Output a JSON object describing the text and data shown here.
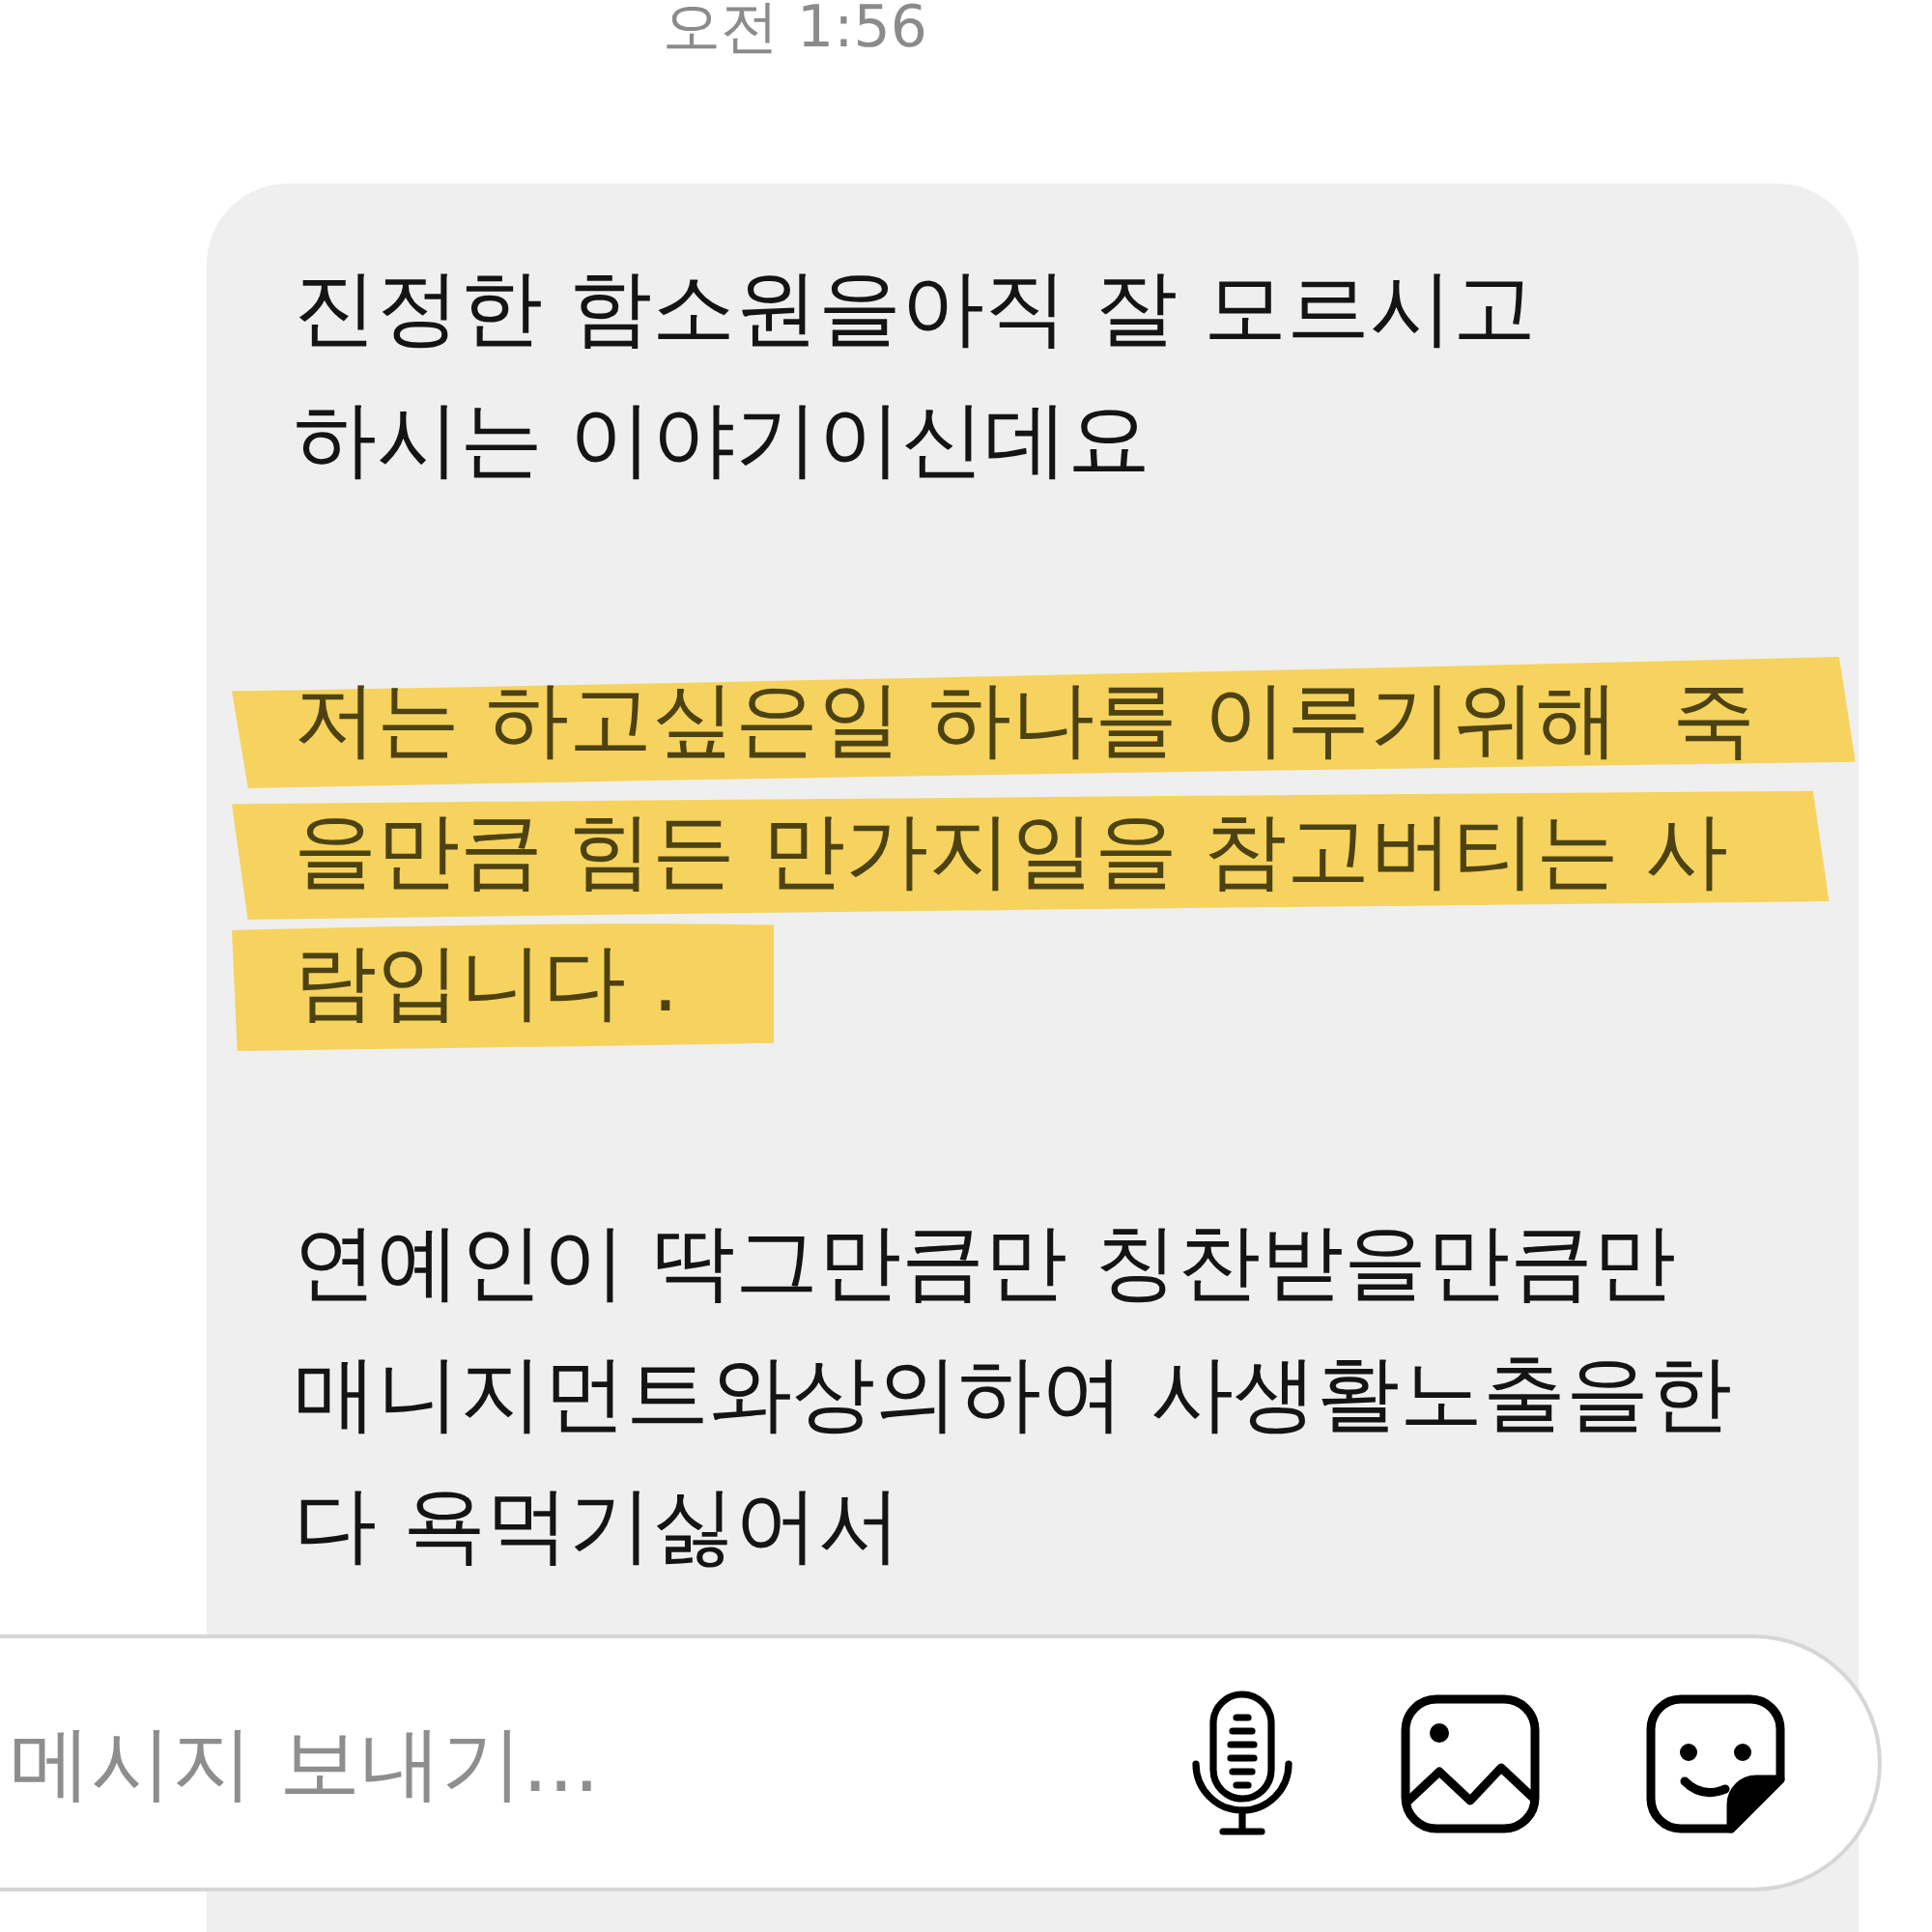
{
  "timestamp": "오전 1:56",
  "message": {
    "paragraphs": [
      {
        "highlighted": false,
        "lines": [
          "진정한 함소원을아직 잘 모르시고",
          "하시는 이야기이신데요"
        ]
      },
      {
        "highlighted": true,
        "lines": [
          "저는 하고싶은일 하나를 이루기위해  죽",
          "을만큼 힘든 만가지일을 참고버티는 사",
          "람입니다 ."
        ]
      },
      {
        "highlighted": false,
        "lines": [
          "연예인이 딱그만큼만 칭찬받을만큼만",
          "매니지먼트와상의하여 사생활노출을한",
          "다 욕먹기싫어서"
        ]
      }
    ]
  },
  "composer": {
    "placeholder": "메시지 보내기..."
  }
}
